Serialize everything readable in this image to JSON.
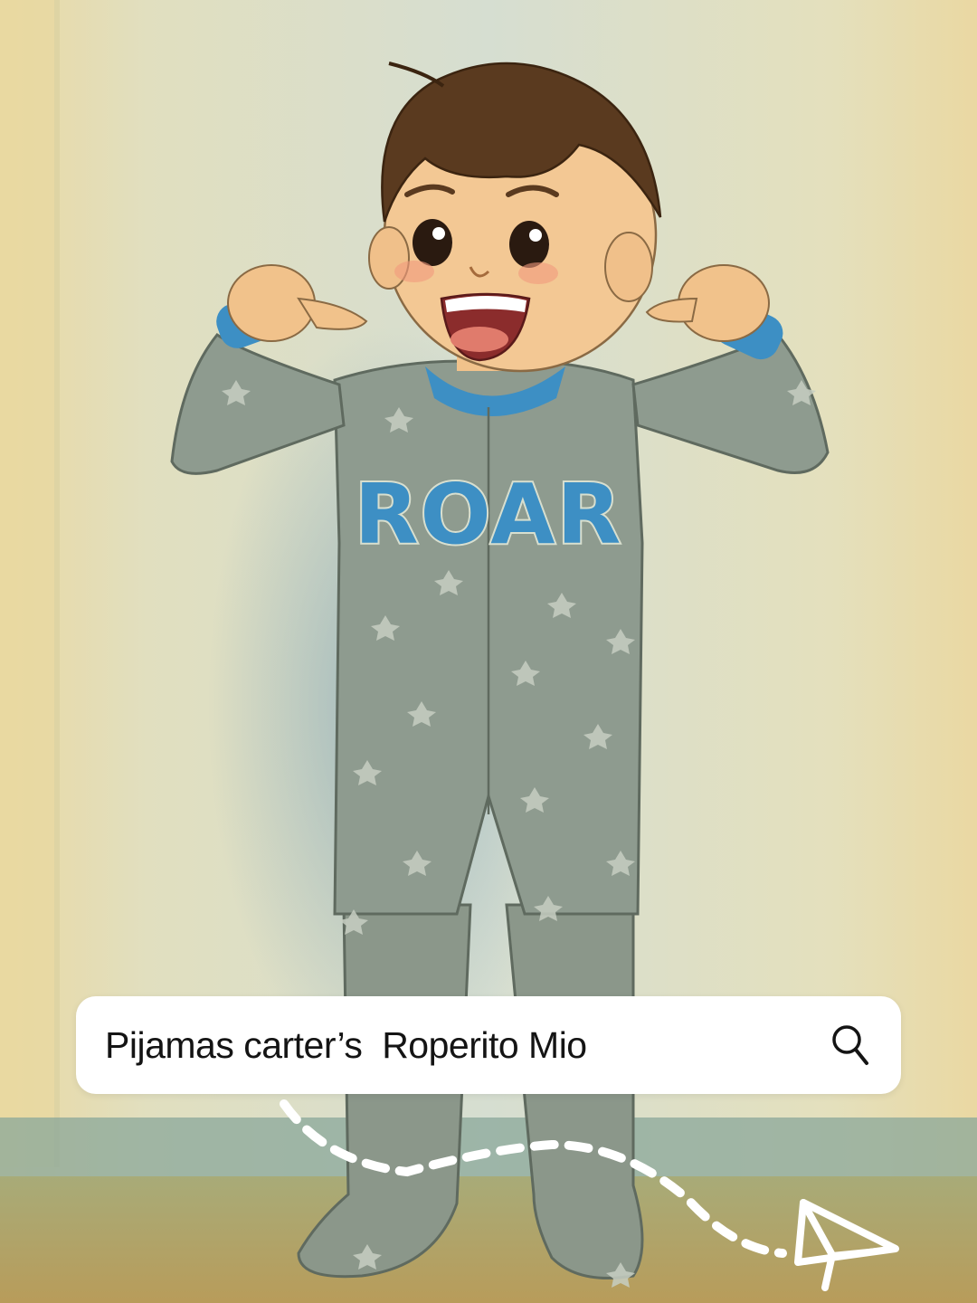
{
  "search": {
    "query": "Pijamas carter’s  Roperito Mio"
  },
  "shirt_print": "ROAR",
  "icons": {
    "search": "search-icon",
    "send": "paper-plane-icon"
  },
  "colors": {
    "background_wall": "#dfe0c2",
    "pajama": "#8e9b8f",
    "pajama_trim": "#3d8fc4",
    "search_bar": "#ffffff",
    "text": "#141414",
    "dashed_path": "#ffffff"
  }
}
